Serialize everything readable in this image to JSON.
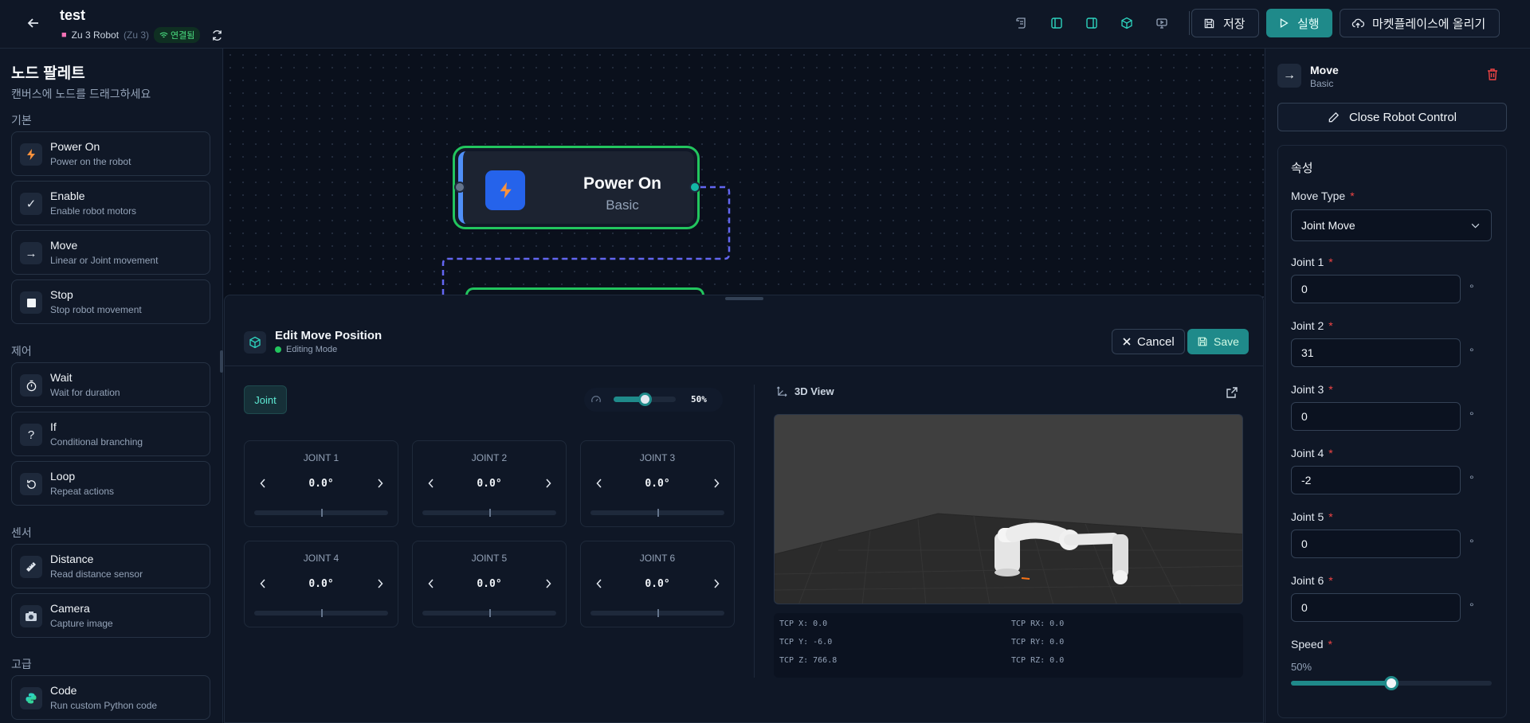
{
  "header": {
    "title": "test",
    "robot_name": "Zu 3 Robot",
    "robot_model": "(Zu 3)",
    "connection_status": "연결됨",
    "save_label": "저장",
    "run_label": "실행",
    "upload_label": "마켓플레이스에 올리기",
    "colors": {
      "accent": "#1f8a8a",
      "connected": "#4ade80"
    }
  },
  "palette": {
    "title": "노드 팔레트",
    "subtitle": "캔버스에 노드를 드래그하세요",
    "categories": [
      {
        "label": "기본",
        "items": [
          {
            "name": "Power On",
            "desc": "Power on the robot",
            "icon": "lightning-icon"
          },
          {
            "name": "Enable",
            "desc": "Enable robot motors",
            "icon": "check-icon"
          },
          {
            "name": "Move",
            "desc": "Linear or Joint movement",
            "icon": "arrow-right-icon"
          },
          {
            "name": "Stop",
            "desc": "Stop robot movement",
            "icon": "stop-icon"
          }
        ]
      },
      {
        "label": "제어",
        "items": [
          {
            "name": "Wait",
            "desc": "Wait for duration",
            "icon": "timer-icon"
          },
          {
            "name": "If",
            "desc": "Conditional branching",
            "icon": "question-icon"
          },
          {
            "name": "Loop",
            "desc": "Repeat actions",
            "icon": "loop-icon"
          }
        ]
      },
      {
        "label": "센서",
        "items": [
          {
            "name": "Distance",
            "desc": "Read distance sensor",
            "icon": "ruler-icon"
          },
          {
            "name": "Camera",
            "desc": "Capture image",
            "icon": "camera-icon"
          }
        ]
      },
      {
        "label": "고급",
        "items": [
          {
            "name": "Code",
            "desc": "Run custom Python code",
            "icon": "python-icon"
          }
        ]
      }
    ]
  },
  "canvas": {
    "node": {
      "name": "Power On",
      "category": "Basic",
      "icon": "lightning-icon"
    }
  },
  "edit_panel": {
    "title": "Edit Move Position",
    "mode": "Editing Mode",
    "cancel_label": "Cancel",
    "save_label": "Save",
    "tab_label": "Joint",
    "speed_percent": "50%",
    "speed_fraction": 0.5,
    "view_label": "3D View",
    "joints": [
      {
        "label": "JOINT 1",
        "value": "0.0°"
      },
      {
        "label": "JOINT 2",
        "value": "0.0°"
      },
      {
        "label": "JOINT 3",
        "value": "0.0°"
      },
      {
        "label": "JOINT 4",
        "value": "0.0°"
      },
      {
        "label": "JOINT 5",
        "value": "0.0°"
      },
      {
        "label": "JOINT 6",
        "value": "0.0°"
      }
    ],
    "tcp": [
      "TCP X: 0.0",
      "TCP RX: 0.0",
      "TCP Y: -6.0",
      "TCP RY: 0.0",
      "TCP Z: 766.8",
      "TCP RZ: 0.0"
    ]
  },
  "properties": {
    "node_name": "Move",
    "node_category": "Basic",
    "close_label": "Close Robot Control",
    "section_title": "속성",
    "move_type_label": "Move Type",
    "move_type_value": "Joint Move",
    "fields": [
      {
        "label": "Joint 1",
        "value": "0"
      },
      {
        "label": "Joint 2",
        "value": "31"
      },
      {
        "label": "Joint 3",
        "value": "0"
      },
      {
        "label": "Joint 4",
        "value": "-2"
      },
      {
        "label": "Joint 5",
        "value": "0"
      },
      {
        "label": "Joint 6",
        "value": "0"
      }
    ],
    "unit": "°",
    "speed_label": "Speed",
    "speed_value": "50%",
    "speed_fraction": 0.5
  }
}
